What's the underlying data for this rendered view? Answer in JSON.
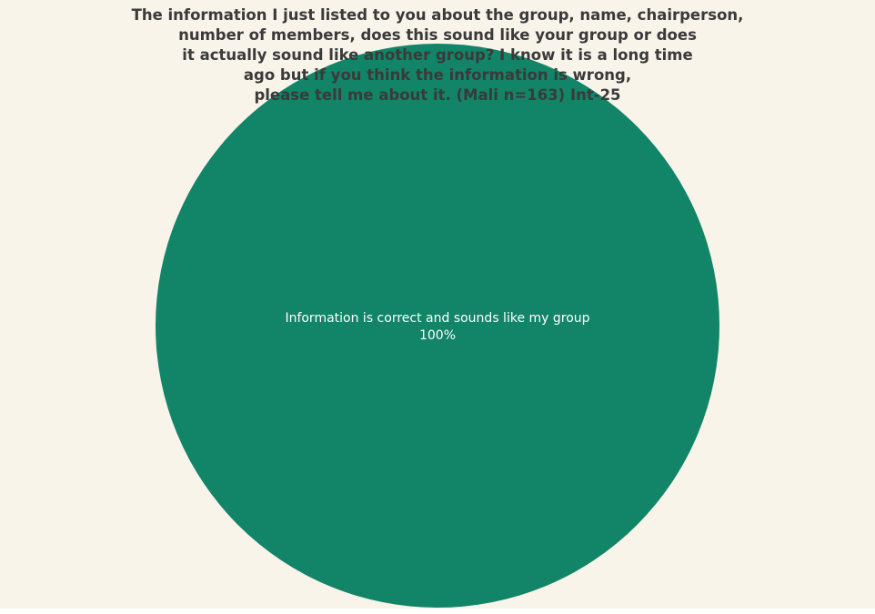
{
  "chart_data": {
    "type": "pie",
    "title_lines": [
      "The information I just listed to you about the group, name, chairperson,",
      "number of members, does this sound like your group or does",
      "it actually sound like another group? I know it is a long time",
      "ago but if you think the information is wrong,",
      "please tell me about it. (Mali n=163) Int-25"
    ],
    "slices": [
      {
        "label": "Information is correct and sounds like my group",
        "value": 100,
        "value_label": "100%",
        "color": "#128467"
      }
    ]
  },
  "colors": {
    "panel_background": "#f8f4ea",
    "title_text": "#3a3a3a",
    "slice_label_text": "#ffffff"
  }
}
